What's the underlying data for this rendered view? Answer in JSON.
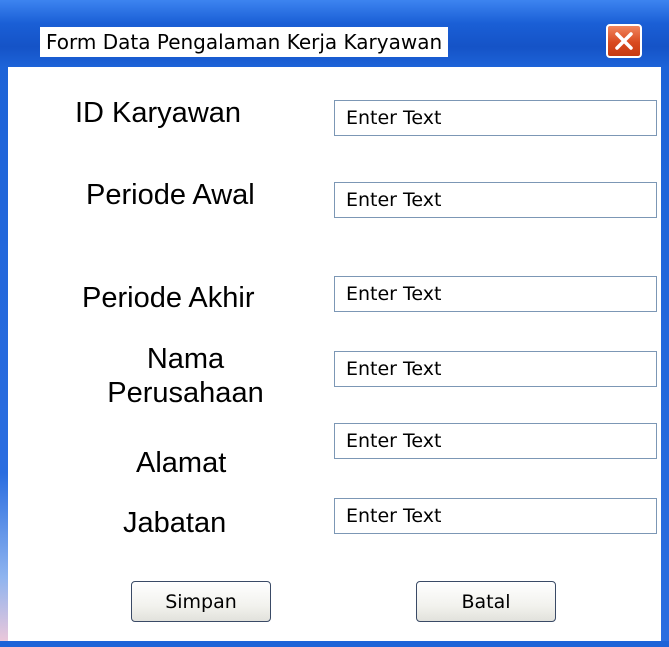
{
  "window": {
    "title": "Form Data Pengalaman Kerja Karyawan"
  },
  "form": {
    "fields": [
      {
        "label": "ID Karyawan",
        "placeholder": "Enter Text"
      },
      {
        "label": "Periode Awal",
        "placeholder": "Enter Text"
      },
      {
        "label": "Periode Akhir",
        "placeholder": "Enter Text"
      },
      {
        "label_line1": "Nama",
        "label_line2": "Perusahaan",
        "placeholder": "Enter Text"
      },
      {
        "label": "Alamat",
        "placeholder": "Enter Text"
      },
      {
        "label": "Jabatan",
        "placeholder": "Enter Text"
      }
    ]
  },
  "buttons": {
    "save_label": "Simpan",
    "cancel_label": "Batal"
  },
  "colors": {
    "titlebar": "#1a5fd6",
    "close_button": "#d94a1f"
  }
}
